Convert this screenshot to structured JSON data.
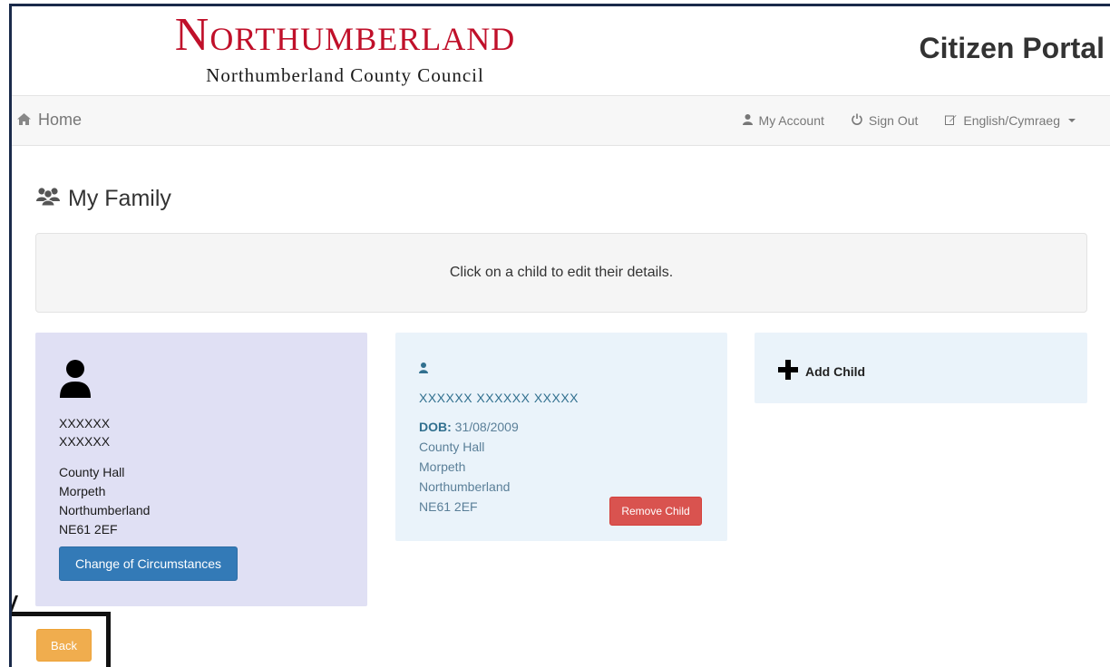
{
  "header": {
    "logo_main": "Northumberland",
    "logo_sub": "Northumberland County Council",
    "portal_title": "Citizen Portal"
  },
  "nav": {
    "home": "Home",
    "my_account": "My Account",
    "sign_out": "Sign Out",
    "language": "English/Cymraeg"
  },
  "page": {
    "title": "My Family",
    "info": "Click on a child to edit their details."
  },
  "parent": {
    "first_name": "XXXXXX",
    "last_name": "XXXXXX",
    "address": [
      "County Hall",
      "Morpeth",
      "Northumberland",
      "NE61 2EF"
    ],
    "button": "Change of Circumstances"
  },
  "child": {
    "name": "XXXXXX XXXXXX XXXXX",
    "dob_label": "DOB:",
    "dob": "31/08/2009",
    "address": [
      "County Hall",
      "Morpeth",
      "Northumberland",
      "NE61 2EF"
    ],
    "button": "Remove Child"
  },
  "add_child": {
    "label": "Add Child"
  },
  "back": {
    "label": "Back"
  },
  "colors": {
    "brand_red": "#c0102a",
    "primary": "#337ab7",
    "danger": "#d9534f",
    "warning": "#f0ad4e",
    "parent_card": "#e0e0f4",
    "child_card": "#eaf3fa"
  },
  "icons": {
    "home": "home-icon",
    "account": "user-icon",
    "sign_out": "power-icon",
    "language": "edit-icon",
    "family": "users-icon",
    "add": "plus-icon"
  }
}
